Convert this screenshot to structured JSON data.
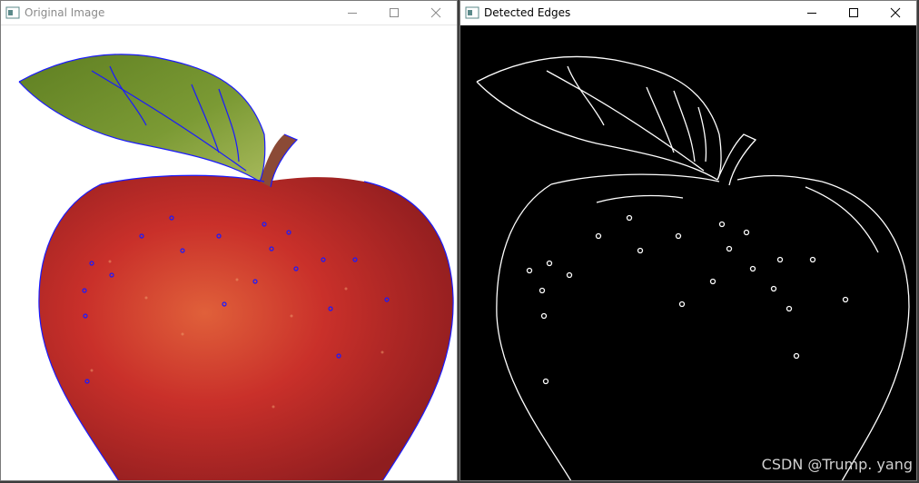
{
  "windows": [
    {
      "id": "left",
      "title": "Original Image",
      "controls": {
        "minimize": "minimize-icon",
        "maximize": "maximize-icon",
        "close": "close-icon"
      },
      "content": "original-image"
    },
    {
      "id": "right",
      "title": "Detected Edges",
      "controls": {
        "minimize": "minimize-icon",
        "maximize": "maximize-icon",
        "close": "close-icon"
      },
      "content": "edge-image"
    }
  ],
  "watermark": "CSDN @Trump. yang",
  "colors": {
    "edge_overlay": "#1a1aff",
    "apple_red": "#c22a2a",
    "leaf_green": "#6e8f2e",
    "edge_white": "#ffffff"
  }
}
